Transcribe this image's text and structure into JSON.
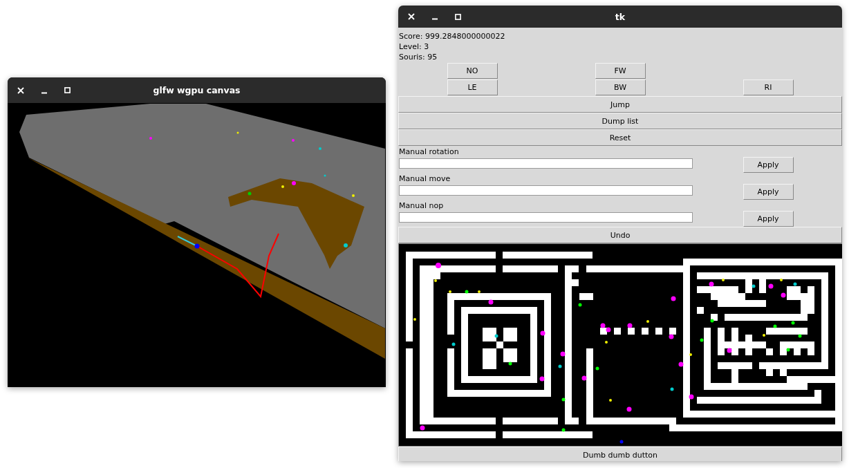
{
  "canvas_window": {
    "title": "glfw wgpu canvas"
  },
  "tk_window": {
    "title": "tk",
    "info_lines": [
      "Score: 999.2848000000022",
      "Level: 3",
      "Souris: 95"
    ],
    "direction_buttons": [
      "NO",
      "FW",
      "LE",
      "BW",
      "RI"
    ],
    "action_buttons": [
      "Jump",
      "Dump list",
      "Reset"
    ],
    "manual_inputs": [
      {
        "label": "Manual rotation",
        "button": "Apply"
      },
      {
        "label": "Manual move",
        "button": "Apply"
      },
      {
        "label": "Manual nop",
        "button": "Apply"
      }
    ],
    "undo_button": "Undo",
    "bottom_button": "Dumb dumb dutton"
  }
}
